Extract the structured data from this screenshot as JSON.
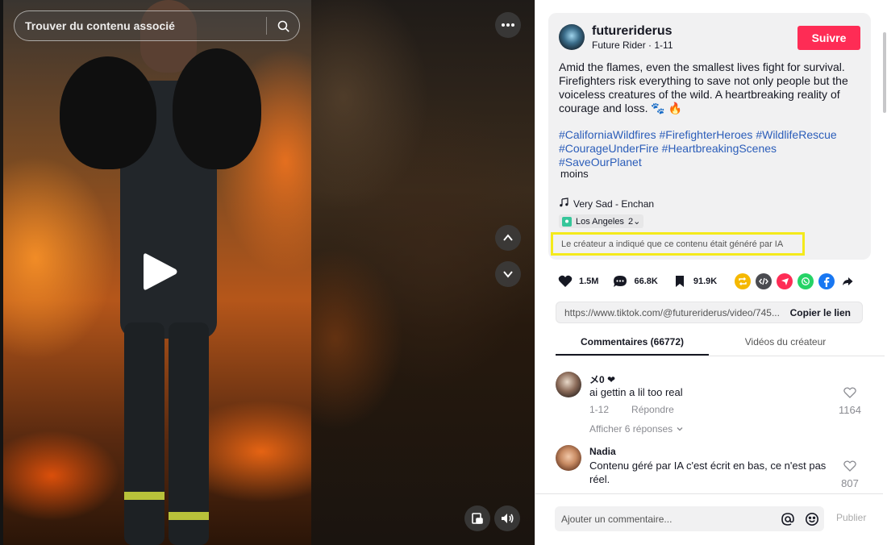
{
  "video": {
    "search_placeholder": "Trouver du contenu associé"
  },
  "author": {
    "username": "futureriderus",
    "display_name": "Future Rider",
    "date": "1-11",
    "separator": " · ",
    "follow_label": "Suivre"
  },
  "post": {
    "caption": "Amid the flames, even the smallest lives fight for survival. Firefighters risk everything to save not only people but the voiceless creatures of the wild. A heartbreaking reality of courage and loss. 🐾 🔥",
    "hashtags": [
      "#CaliforniaWildfires",
      "#FirefighterHeroes",
      "#WildlifeRescue",
      "#CourageUnderFire",
      "#HeartbreakingScenes",
      "#SaveOurPlanet"
    ],
    "less_label": "moins",
    "music": "Very Sad - Enchan",
    "location": "Los Angeles",
    "location_count": "2",
    "ai_label": "Le créateur a indiqué que ce contenu était généré par IA"
  },
  "stats": {
    "likes": "1.5M",
    "comments": "66.8K",
    "saves": "91.9K"
  },
  "share": {
    "icons": [
      "repost-icon",
      "embed-icon",
      "send-icon",
      "whatsapp-icon",
      "facebook-icon",
      "forward-icon"
    ],
    "colors": {
      "repost": "#f5b800",
      "embed": "#4a4b50",
      "send": "#fe2c55",
      "whatsapp": "#25d366",
      "facebook": "#1877f2"
    }
  },
  "link": {
    "url": "https://www.tiktok.com/@futureriderus/video/745...",
    "copy_label": "Copier le lien"
  },
  "tabs": {
    "comments": "Commentaires (66772)",
    "creator_videos": "Vidéos du créateur"
  },
  "comments": [
    {
      "user": "メ0 ❤",
      "text": "ai gettin a lil too real",
      "date": "1-12",
      "reply_label": "Répondre",
      "view_replies": "Afficher 6 réponses",
      "likes": "1164"
    },
    {
      "user": "Nadia",
      "text": "Contenu géré par IA c'est écrit en bas, ce n'est pas réel.",
      "likes": "807"
    }
  ],
  "footer": {
    "comment_placeholder": "Ajouter un commentaire...",
    "publish_label": "Publier"
  },
  "colors": {
    "accent": "#fe2c55",
    "hashtag": "#2b5db9",
    "highlight_box": "#f4ea1b"
  }
}
